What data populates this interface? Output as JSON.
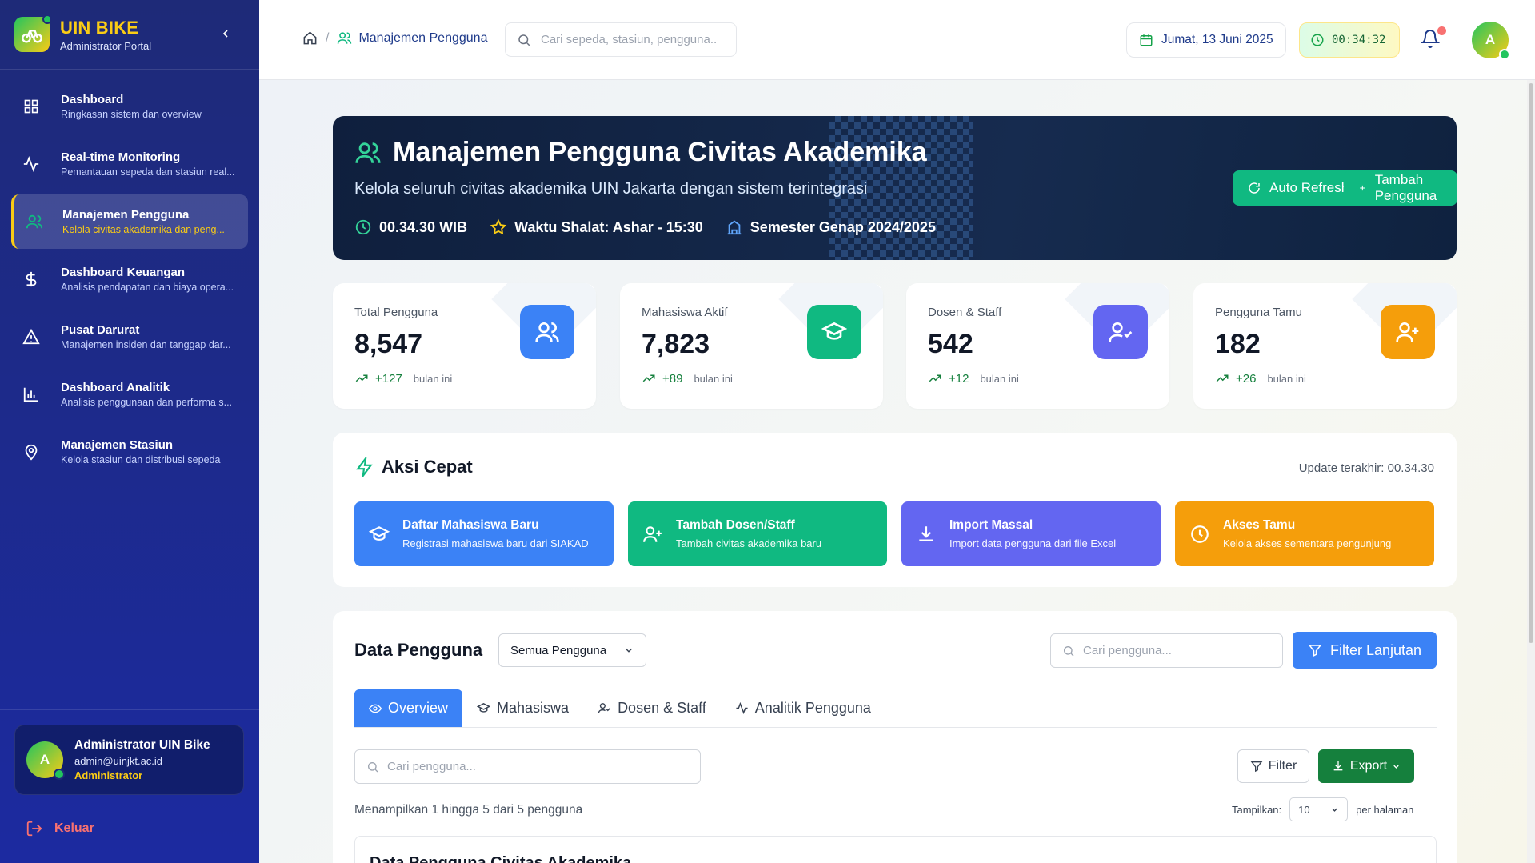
{
  "brand": {
    "title": "UIN BIKE",
    "subtitle": "Administrator Portal"
  },
  "sidebar": {
    "items": [
      {
        "label": "Dashboard",
        "desc": "Ringkasan sistem dan overview",
        "icon": "grid-icon"
      },
      {
        "label": "Real-time Monitoring",
        "desc": "Pemantauan sepeda dan stasiun real...",
        "icon": "activity-icon"
      },
      {
        "label": "Manajemen Pengguna",
        "desc": "Kelola civitas akademika dan peng...",
        "icon": "users-icon",
        "active": true
      },
      {
        "label": "Dashboard Keuangan",
        "desc": "Analisis pendapatan dan biaya opera...",
        "icon": "dollar-icon"
      },
      {
        "label": "Pusat Darurat",
        "desc": "Manajemen insiden dan tanggap dar...",
        "icon": "alert-icon"
      },
      {
        "label": "Dashboard Analitik",
        "desc": "Analisis penggunaan dan performa s...",
        "icon": "bar-chart-icon"
      },
      {
        "label": "Manajemen Stasiun",
        "desc": "Kelola stasiun dan distribusi sepeda",
        "icon": "map-pin-icon"
      }
    ],
    "user": {
      "initial": "A",
      "name": "Administrator UIN Bike",
      "email": "admin@uinjkt.ac.id",
      "role": "Administrator"
    },
    "logout_label": "Keluar"
  },
  "topbar": {
    "breadcrumb_sep": "/",
    "breadcrumb_current": "Manajemen Pengguna",
    "search_placeholder": "Cari sepeda, stasiun, pengguna...",
    "date": "Jumat, 13 Juni 2025",
    "time": "00:34:32",
    "avatar_initial": "A"
  },
  "hero": {
    "title": "Manajemen Pengguna Civitas Akademika",
    "subtitle": "Kelola seluruh civitas akademika UIN Jakarta dengan sistem terintegrasi",
    "clock": "00.34.30 WIB",
    "prayer": "Waktu Shalat: Ashar - 15:30",
    "semester": "Semester Genap 2024/2025",
    "auto_refresh_label": "Auto Refresh",
    "add_user_label": "Tambah Pengguna"
  },
  "stats": [
    {
      "label": "Total Pengguna",
      "value": "8,547",
      "trend": "+127",
      "note": "bulan ini",
      "color": "#3b82f6",
      "icon": "users-icon"
    },
    {
      "label": "Mahasiswa Aktif",
      "value": "7,823",
      "trend": "+89",
      "note": "bulan ini",
      "color": "#10b981",
      "icon": "graduation-cap-icon"
    },
    {
      "label": "Dosen & Staff",
      "value": "542",
      "trend": "+12",
      "note": "bulan ini",
      "color": "#6366f1",
      "icon": "user-check-icon"
    },
    {
      "label": "Pengguna Tamu",
      "value": "182",
      "trend": "+26",
      "note": "bulan ini",
      "color": "#f59e0b",
      "icon": "user-plus-icon"
    }
  ],
  "quick": {
    "title": "Aksi Cepat",
    "updated": "Update terakhir: 00.34.30",
    "actions": [
      {
        "label": "Daftar Mahasiswa Baru",
        "desc": "Registrasi mahasiswa baru dari SIAKAD",
        "color": "#3b82f6",
        "icon": "graduation-cap-icon"
      },
      {
        "label": "Tambah Dosen/Staff",
        "desc": "Tambah civitas akademika baru",
        "color": "#10b981",
        "icon": "user-plus-icon"
      },
      {
        "label": "Import Massal",
        "desc": "Import data pengguna dari file Excel",
        "color": "#6366f1",
        "icon": "download-icon"
      },
      {
        "label": "Akses Tamu",
        "desc": "Kelola akses sementara pengunjung",
        "color": "#f59e0b",
        "icon": "clock-icon"
      }
    ]
  },
  "data": {
    "title": "Data Pengguna",
    "filter_select": "Semua Pengguna",
    "search_placeholder": "Cari pengguna...",
    "advanced_filter_label": "Filter Lanjutan",
    "tabs": [
      {
        "label": "Overview",
        "icon": "eye-icon",
        "active": true
      },
      {
        "label": "Mahasiswa",
        "icon": "graduation-cap-icon"
      },
      {
        "label": "Dosen & Staff",
        "icon": "user-check-icon"
      },
      {
        "label": "Analitik Pengguna",
        "icon": "activity-icon"
      }
    ],
    "list_search_placeholder": "Cari pengguna...",
    "filter_label": "Filter",
    "export_label": "Export",
    "showing": "Menampilkan 1 hingga 5 dari 5 pengguna",
    "perpage_label": "Tampilkan:",
    "perpage_value": "10",
    "perpage_suffix": "per halaman",
    "table_title": "Data Pengguna Civitas Akademika"
  }
}
